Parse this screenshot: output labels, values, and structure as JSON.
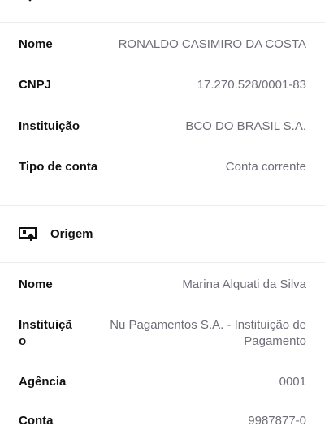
{
  "destino": {
    "rows": [
      {
        "label": "Nome",
        "value": "RONALDO CASIMIRO DA COSTA"
      },
      {
        "label": "CNPJ",
        "value": "17.270.528/0001-83"
      },
      {
        "label": "Instituição",
        "value": "BCO DO BRASIL S.A."
      },
      {
        "label": "Tipo de conta",
        "value": "Conta corrente"
      }
    ]
  },
  "origem": {
    "title": "Origem",
    "icon": "screen-upload-icon",
    "rows": [
      {
        "label": "Nome",
        "value": "Marina Alquati da Silva"
      },
      {
        "label_line1": "Instituiçã",
        "label_line2": "o",
        "value_line1": "Nu Pagamentos S.A. - Instituição de",
        "value_line2": "Pagamento"
      },
      {
        "label": "Agência",
        "value": "0001"
      },
      {
        "label": "Conta",
        "value": "9987877-0"
      }
    ]
  },
  "colors": {
    "label": "#111111",
    "value": "#6e6e78",
    "divider": "#ececec"
  }
}
